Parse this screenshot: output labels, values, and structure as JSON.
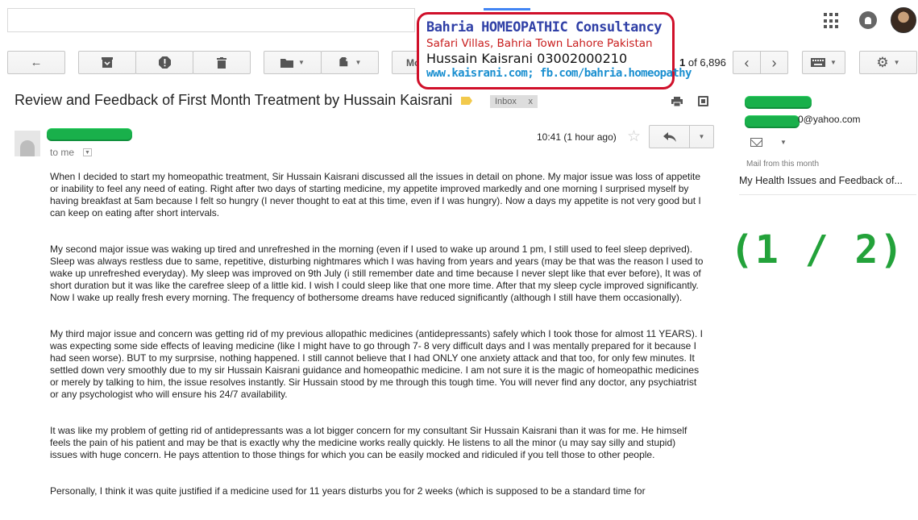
{
  "toolbar": {
    "pager_current": "1",
    "pager_of": "of 6,896"
  },
  "subject": {
    "title": "Review and Feedback of First Month Treatment by Hussain Kaisrani",
    "label": "Inbox",
    "label_remove": "x"
  },
  "message": {
    "to": "to me",
    "time": "10:41 (1 hour ago)",
    "paragraphs": [
      "When I decided to start my homeopathic treatment, Sir Hussain Kaisrani discussed all the issues in detail on phone. My major issue was loss of appetite or inability to feel any need of eating. Right after two days of starting medicine, my appetite improved markedly and one morning I surprised myself by having breakfast at 5am because I felt so hungry (I never thought to eat at this time, even if I was hungry). Now a days my appetite is not very good but I can keep on eating after short intervals.",
      "My second major issue was waking up tired and unrefreshed in the morning (even if I used to wake up around 1 pm, I still used to feel sleep deprived). Sleep was always restless due to same, repetitive, disturbing nightmares which I was having from years and years (may be that was the reason I used to wake up unrefreshed everyday). My sleep was improved on 9th July (i still remember date and time because I never slept like that ever before), It was of short duration but it was like the carefree sleep of a little kid. I wish I could sleep like that one more time. After that my sleep cycle improved significantly. Now I wake up really fresh every morning. The frequency of bothersome dreams have reduced significantly (although I still have them occasionally).",
      "My third major issue and concern was getting rid of my previous allopathic medicines (antidepressants) safely which I took those for almost 11 YEARS). I was expecting some side effects of leaving medicine (like I might have to go through 7- 8 very difficult days and I was mentally prepared for it because I had seen worse). BUT to my surprsise, nothing happened. I still cannot believe that I had ONLY one anxiety attack and that too, for only few minutes. It settled down very smoothly due to my sir Hussain Kaisrani guidance and homeopathic medicine. I am not sure it is the magic of homeopathic medicines or merely by talking to him, the issue resolves instantly. Sir Hussain stood by me through this tough time. You will never find any doctor, any psychiatrist or any psychologist who will ensure his 24/7 availability.",
      "It was like my problem of getting rid of antidepressants was a lot bigger concern for my consultant Sir Hussain Kaisrani than it was for me. He himself feels the pain of his patient and may be that is exactly why the medicine works really quickly. He listens to all the minor (u may say silly and stupid) issues with huge concern. He pays attention to those things for which you can be easily mocked and ridiculed if you tell those to other people.",
      "Personally, I think it was quite justified if a medicine used for 11 years disturbs you for 2 weeks (which is supposed to be a standard time for"
    ]
  },
  "sidebar": {
    "email_suffix": "0@yahoo.com",
    "heading": "Mail from this month",
    "item": "My Health Issues and Feedback of..."
  },
  "page_counter": "(1 / 2)",
  "promo": {
    "line1": "Bahria HOMEOPATHIC Consultancy",
    "line2": "Safari Villas,  Bahria Town Lahore  Pakistan",
    "line3": "Hussain Kaisrani 03002000210",
    "line4": "www.kaisrani.com; fb.com/bahria.homeopathy"
  },
  "icons": {
    "back": "arrow-left-icon",
    "archive": "archive-icon",
    "spam": "report-spam-icon",
    "delete": "trash-icon",
    "move": "folder-icon",
    "labels": "label-icon",
    "prev": "chevron-left-icon",
    "next": "chevron-right-icon",
    "keyboard": "keyboard-icon",
    "settings": "gear-icon",
    "reply": "reply-icon",
    "star": "star-icon"
  },
  "colors": {
    "redaction": "#19b04b",
    "counter": "#23a23a",
    "promo_border": "#d0102a",
    "promo_title": "#2f3fa6",
    "label_tag": "#f2c94c"
  }
}
